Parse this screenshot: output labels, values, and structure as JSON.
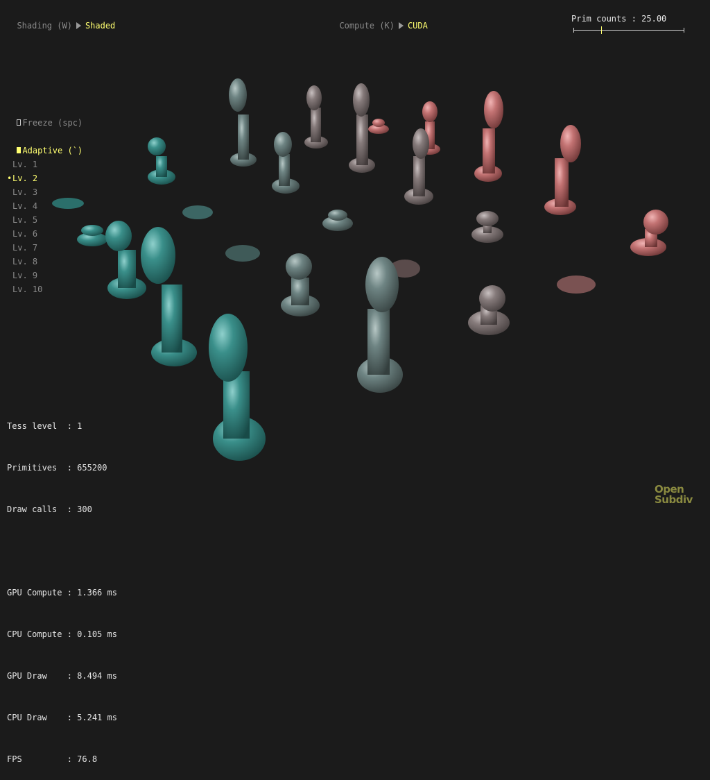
{
  "header": {
    "shading_label": "Shading (W)",
    "shading_value": "Shaded",
    "compute_label": "Compute (K)",
    "compute_value": "CUDA"
  },
  "prim_counts": {
    "label": "Prim counts : 25.00",
    "value": 25.0
  },
  "options": {
    "freeze_label": "Freeze (spc)",
    "freeze_checked": false,
    "adaptive_label": "Adaptive (`)",
    "adaptive_checked": true
  },
  "levels": {
    "selected": "Lv. 2",
    "items": [
      "Lv. 1",
      "Lv. 2",
      "Lv. 3",
      "Lv. 4",
      "Lv. 5",
      "Lv. 6",
      "Lv. 7",
      "Lv. 8",
      "Lv. 9",
      "Lv. 10"
    ]
  },
  "stats": {
    "tess_level": "Tess level  : 1",
    "primitives": "Primitives  : 655200",
    "draw_calls": "Draw calls  : 300",
    "gpu_compute": "GPU Compute : 1.366 ms",
    "cpu_compute": "CPU Compute : 0.105 ms",
    "gpu_draw": "GPU Draw    : 8.494 ms",
    "cpu_draw": "CPU Draw    : 5.241 ms",
    "fps": "FPS         : 76.8"
  },
  "logo": {
    "line1": "Open",
    "line2": "Subdiv"
  },
  "colors": {
    "background": "#1b1b1b",
    "teal": "#2f7c78",
    "rose": "#b06a6a",
    "highlight": "#ffff70"
  }
}
